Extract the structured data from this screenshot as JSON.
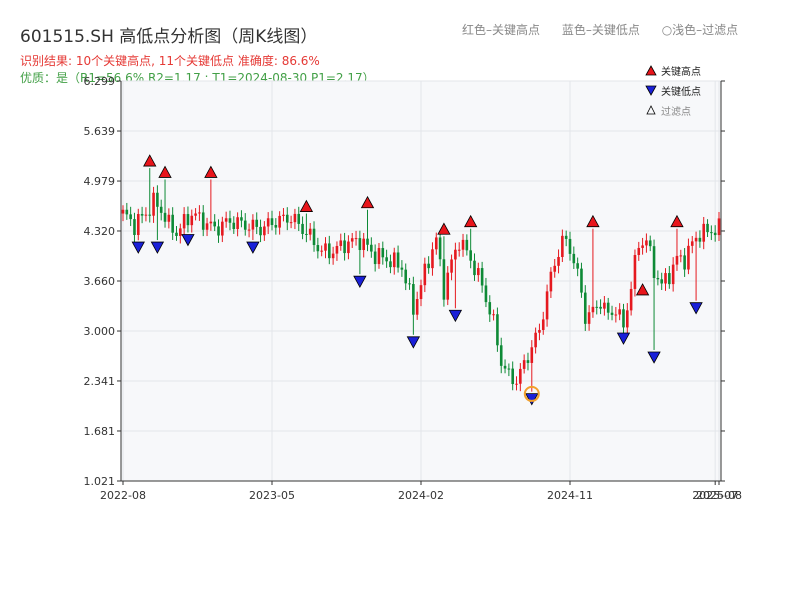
{
  "title": "601515.SH 高低点分析图（周K线图）",
  "legend_top": [
    "红色–关键高点",
    "蓝色–关键低点",
    "○浅色–过滤点"
  ],
  "summary": {
    "result": "识别结果: 10个关键高点, 11个关键低点  准确度: 86.6%",
    "quality": "优质：是（R1=56.6%  R2=1.17 ; T1=2024-08-30 P1=2.17）"
  },
  "colors": {
    "up": "#e5191f",
    "down": "#0e8a36",
    "high_marker": "#e8151b",
    "low_marker": "#1a20d8",
    "filtered": "#f2a02c",
    "plot_bg": "#f7f8fa",
    "grid": "#e3e6ea"
  },
  "chart_data": {
    "type": "candlestick",
    "y_ticks": [
      "6.299",
      "5.639",
      "4.979",
      "4.320",
      "3.660",
      "3.000",
      "2.341",
      "1.681",
      "1.021"
    ],
    "ylim": [
      1.021,
      6.299
    ],
    "x_ticks": [
      "2022-08",
      "2023-05",
      "2024-02",
      "2024-11",
      "2025-07",
      "2025-08"
    ],
    "x_range_weeks": 156,
    "x_tick_weeks": [
      0,
      39,
      78,
      117,
      155,
      156
    ],
    "close_path": [
      [
        0,
        4.55
      ],
      [
        3,
        4.4
      ],
      [
        6,
        4.55
      ],
      [
        8,
        4.7
      ],
      [
        10,
        4.6
      ],
      [
        12,
        4.4
      ],
      [
        14,
        4.3
      ],
      [
        18,
        4.55
      ],
      [
        21,
        4.45
      ],
      [
        24,
        4.35
      ],
      [
        28,
        4.45
      ],
      [
        32,
        4.4
      ],
      [
        36,
        4.35
      ],
      [
        40,
        4.45
      ],
      [
        44,
        4.5
      ],
      [
        48,
        4.3
      ],
      [
        52,
        4.05
      ],
      [
        55,
        4.05
      ],
      [
        58,
        4.15
      ],
      [
        62,
        4.2
      ],
      [
        66,
        4.0
      ],
      [
        69,
        3.95
      ],
      [
        73,
        3.85
      ],
      [
        76,
        3.3
      ],
      [
        78,
        3.6
      ],
      [
        80,
        3.95
      ],
      [
        82,
        4.2
      ],
      [
        84,
        3.55
      ],
      [
        86,
        3.9
      ],
      [
        88,
        4.2
      ],
      [
        91,
        3.95
      ],
      [
        94,
        3.6
      ],
      [
        97,
        3.1
      ],
      [
        99,
        2.6
      ],
      [
        101,
        2.4
      ],
      [
        103,
        2.35
      ],
      [
        105,
        2.55
      ],
      [
        107,
        2.8
      ],
      [
        109,
        3.0
      ],
      [
        111,
        3.5
      ],
      [
        113,
        3.9
      ],
      [
        115,
        4.2
      ],
      [
        117,
        4.1
      ],
      [
        119,
        3.75
      ],
      [
        121,
        3.2
      ],
      [
        123,
        3.25
      ],
      [
        125,
        3.4
      ],
      [
        127,
        3.2
      ],
      [
        129,
        3.3
      ],
      [
        131,
        3.05
      ],
      [
        133,
        3.6
      ],
      [
        135,
        4.15
      ],
      [
        137,
        4.2
      ],
      [
        139,
        3.8
      ],
      [
        141,
        3.6
      ],
      [
        143,
        3.75
      ],
      [
        145,
        3.95
      ],
      [
        147,
        3.95
      ],
      [
        149,
        4.15
      ],
      [
        151,
        4.3
      ],
      [
        153,
        4.3
      ],
      [
        155,
        4.35
      ],
      [
        156,
        4.35
      ]
    ],
    "key_highs": [
      {
        "week": 7,
        "value": 5.15
      },
      {
        "week": 11,
        "value": 5.0
      },
      {
        "week": 23,
        "value": 5.0
      },
      {
        "week": 48,
        "value": 4.55
      },
      {
        "week": 64,
        "value": 4.6
      },
      {
        "week": 84,
        "value": 4.25
      },
      {
        "week": 91,
        "value": 4.35
      },
      {
        "week": 123,
        "value": 4.35
      },
      {
        "week": 136,
        "value": 3.45
      },
      {
        "week": 145,
        "value": 4.35
      }
    ],
    "key_lows": [
      {
        "week": 4,
        "value": 4.2
      },
      {
        "week": 9,
        "value": 4.2
      },
      {
        "week": 17,
        "value": 4.3
      },
      {
        "week": 34,
        "value": 4.2
      },
      {
        "week": 62,
        "value": 3.75
      },
      {
        "week": 76,
        "value": 2.95
      },
      {
        "week": 87,
        "value": 3.3
      },
      {
        "week": 107,
        "value": 2.2
      },
      {
        "week": 131,
        "value": 3.0
      },
      {
        "week": 139,
        "value": 2.75
      },
      {
        "week": 150,
        "value": 3.4
      }
    ],
    "filtered_points": [
      {
        "week": 107,
        "value": 2.17
      }
    ],
    "legend": [
      "关键高点",
      "关键低点",
      "过滤点"
    ],
    "grid": true,
    "legend_position": "top-right"
  }
}
